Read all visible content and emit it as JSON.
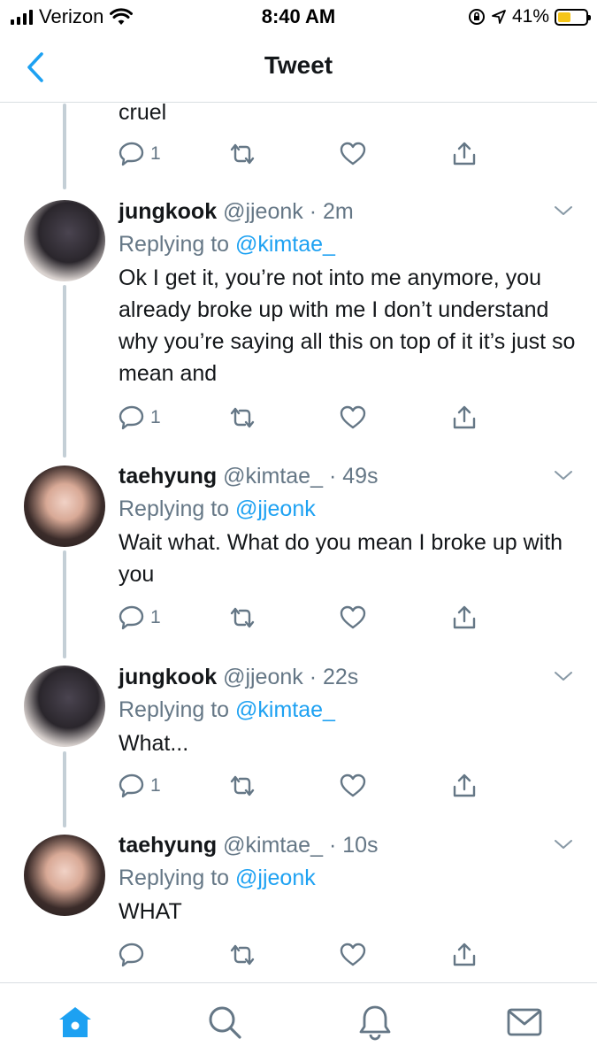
{
  "status_bar": {
    "carrier": "Verizon",
    "time": "8:40 AM",
    "battery": "41%",
    "battery_color": "#f5c518"
  },
  "nav": {
    "title": "Tweet",
    "back_icon": "chevron-left-icon"
  },
  "accent_color": "#1da1f2",
  "previous_tweet": {
    "text": "cruel",
    "reply_count": "1"
  },
  "tweets": [
    {
      "name": "jungkook",
      "handle": "@jjeonk",
      "time": "2m",
      "replying_prefix": "Replying to",
      "replying_to": "@kimtae_",
      "text": "Ok I get it, you’re not into me anymore, you already broke up with me I don’t understand why you’re saying all this on top of it it’s just so mean and",
      "reply_count": "1"
    },
    {
      "name": "taehyung",
      "handle": "@kimtae_",
      "time": "49s",
      "replying_prefix": "Replying to",
      "replying_to": "@jjeonk",
      "text": "Wait what. What do you mean I broke up with you",
      "reply_count": "1"
    },
    {
      "name": "jungkook",
      "handle": "@jjeonk",
      "time": "22s",
      "replying_prefix": "Replying to",
      "replying_to": "@kimtae_",
      "text": "What...",
      "reply_count": "1"
    },
    {
      "name": "taehyung",
      "handle": "@kimtae_",
      "time": "10s",
      "replying_prefix": "Replying to",
      "replying_to": "@jjeonk",
      "text": "WHAT",
      "reply_count": ""
    }
  ],
  "tab_bar": {
    "items": [
      "home-icon",
      "search-icon",
      "notifications-icon",
      "messages-icon"
    ]
  }
}
